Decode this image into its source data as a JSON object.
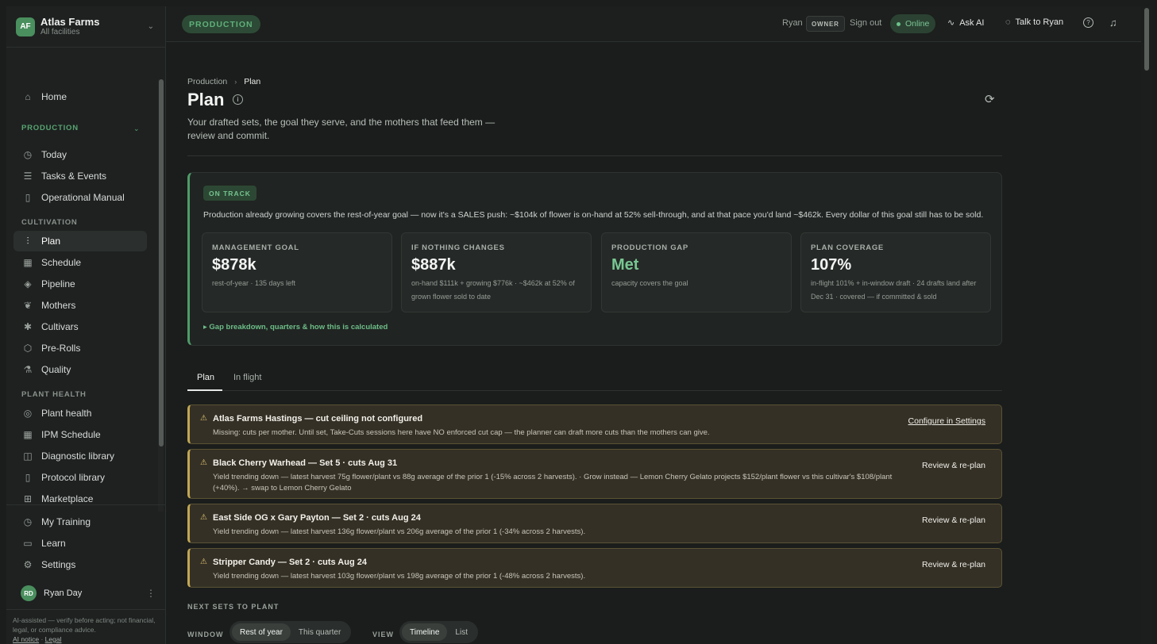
{
  "org": {
    "initials": "AF",
    "name": "Atlas Farms",
    "subtitle": "All facilities"
  },
  "sidebar": {
    "home": "Home",
    "production_section": "PRODUCTION",
    "today": "Today",
    "tasks": "Tasks & Events",
    "manual": "Operational Manual",
    "cultivation_section": "CULTIVATION",
    "plan": "Plan",
    "schedule": "Schedule",
    "pipeline": "Pipeline",
    "mothers": "Mothers",
    "cultivars": "Cultivars",
    "prerolls": "Pre-Rolls",
    "quality": "Quality",
    "plant_health_section": "PLANT HEALTH",
    "plant_health": "Plant health",
    "ipm": "IPM Schedule",
    "diagnostic": "Diagnostic library",
    "protocol": "Protocol library",
    "marketplace": "Marketplace",
    "training": "My Training",
    "learn": "Learn",
    "settings": "Settings"
  },
  "user": {
    "initials": "RD",
    "name": "Ryan Day"
  },
  "disclaimer": {
    "text": "AI-assisted — verify before acting; not financial, legal, or compliance advice.",
    "ai_notice": "AI notice",
    "legal": "Legal"
  },
  "topbar": {
    "context": "PRODUCTION",
    "user": "Ryan",
    "role": "OWNER",
    "signout": "Sign out",
    "status": "Online",
    "ask_ai": "Ask AI",
    "talk": "Talk to Ryan"
  },
  "page": {
    "breadcrumb_parent": "Production",
    "breadcrumb_current": "Plan",
    "title": "Plan",
    "description": "Your drafted sets, the goal they serve, and the mothers that feed them — review and commit."
  },
  "summary": {
    "status": "ON TRACK",
    "text": "Production already growing covers the rest-of-year goal — now it's a SALES push: ~$104k of flower is on-hand at 52% sell-through, and at that pace you'd land ~$462k. Every dollar of this goal still has to be sold.",
    "metrics": [
      {
        "label": "MANAGEMENT GOAL",
        "value": "$878k",
        "note": "rest-of-year · 135 days left"
      },
      {
        "label": "IF NOTHING CHANGES",
        "value": "$887k",
        "note": "on-hand $111k + growing $776k · ~$462k at 52% of grown flower sold to date"
      },
      {
        "label": "PRODUCTION GAP",
        "value": "Met",
        "note": "capacity covers the goal"
      },
      {
        "label": "PLAN COVERAGE",
        "value": "107%",
        "note": "in-flight 101% + in-window draft · 24 drafts land after Dec 31 · covered — if committed & sold"
      }
    ],
    "gap_link": "Gap breakdown, quarters & how this is calculated"
  },
  "tabs": {
    "plan": "Plan",
    "in_flight": "In flight"
  },
  "alerts": [
    {
      "title": "Atlas Farms Hastings — cut ceiling not configured",
      "body": "Missing: cuts per mother. Until set, Take-Cuts sessions here have NO enforced cut cap — the planner can draft more cuts than the mothers can give.",
      "action": "Configure in Settings"
    },
    {
      "title": "Black Cherry Warhead — Set 5 · cuts Aug 31",
      "body": "Yield trending down — latest harvest 75g flower/plant vs 88g average of the prior 1 (-15% across 2 harvests). · Grow instead — Lemon Cherry Gelato projects $152/plant flower vs this cultivar's $108/plant (+40%). → swap to Lemon Cherry Gelato",
      "action": "Review & re-plan"
    },
    {
      "title": "East Side OG x Gary Payton — Set 2 · cuts Aug 24",
      "body": "Yield trending down — latest harvest 136g flower/plant vs 206g average of the prior 1 (-34% across 2 harvests).",
      "action": "Review & re-plan"
    },
    {
      "title": "Stripper Candy — Set 2 · cuts Aug 24",
      "body": "Yield trending down — latest harvest 103g flower/plant vs 198g average of the prior 1 (-48% across 2 harvests).",
      "action": "Review & re-plan"
    }
  ],
  "planning": {
    "next_sets": "NEXT SETS TO PLANT",
    "window_label": "WINDOW",
    "window_options": [
      "Rest of year",
      "This quarter"
    ],
    "view_label": "VIEW",
    "view_options": [
      "Timeline",
      "List"
    ]
  }
}
